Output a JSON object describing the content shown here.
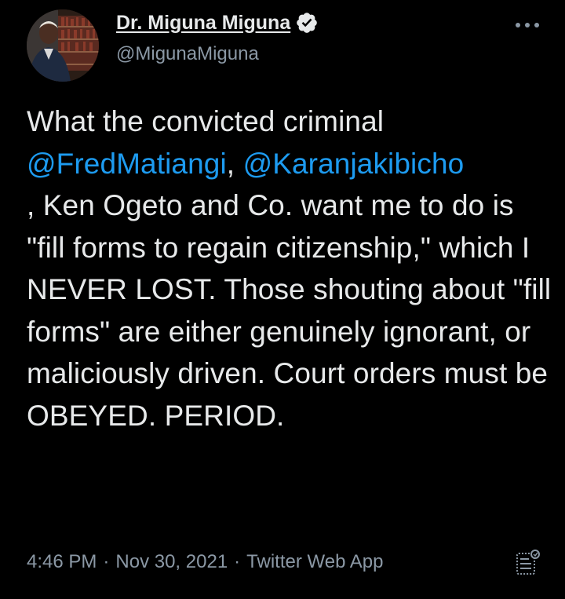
{
  "author": {
    "display_name": "Dr. Miguna Miguna",
    "handle": "@MigunaMiguna",
    "verified": true
  },
  "tweet": {
    "segments": [
      {
        "text": "What the convicted criminal ",
        "type": "text"
      },
      {
        "text": "@FredMatiangi",
        "type": "mention"
      },
      {
        "text": ", ",
        "type": "text"
      },
      {
        "text": "@Karanjakibicho",
        "type": "mention"
      },
      {
        "text": ", Ken Ogeto and Co. want me to do is \"fill forms to regain citizenship,\" which I NEVER LOST. Those shouting about \"fill forms\" are either genuinely ignorant, or maliciously driven. Court orders must be OBEYED. PERIOD.",
        "type": "text"
      }
    ]
  },
  "meta": {
    "time": "4:46 PM",
    "date": "Nov 30, 2021",
    "source": "Twitter Web App",
    "separator": "·"
  },
  "icons": {
    "verified": "verified-badge-icon",
    "more": "more-options-icon",
    "analytics": "analytics-icon"
  },
  "colors": {
    "background": "#000000",
    "text": "#e7e9ea",
    "secondary": "#8b98a5",
    "accent": "#1d9bf0"
  }
}
